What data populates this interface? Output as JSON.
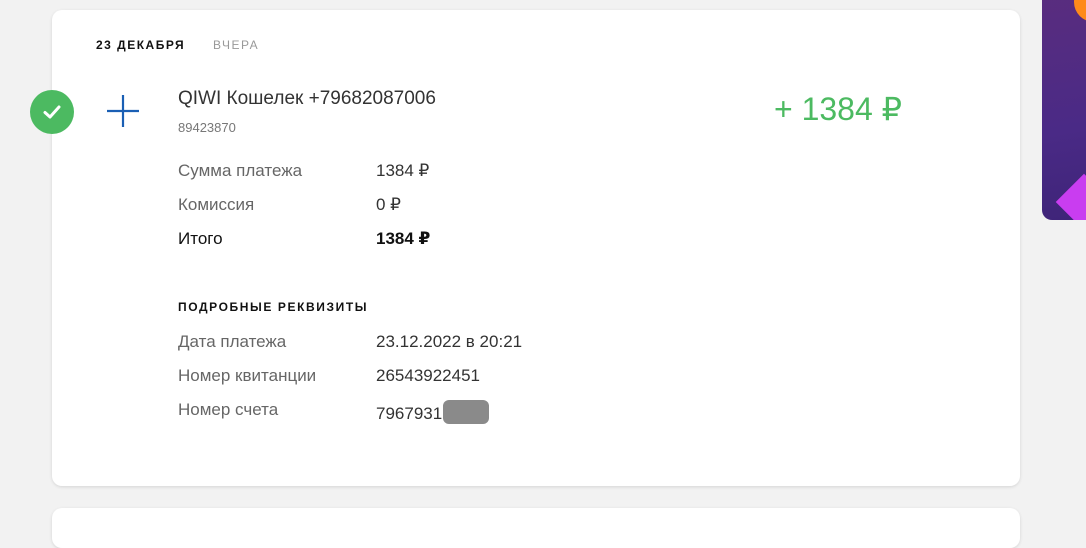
{
  "header": {
    "date": "23 ДЕКАБРЯ",
    "relative_day": "ВЧЕРА"
  },
  "transaction": {
    "status_icon": "check-icon",
    "type_icon": "plus-icon",
    "title": "QIWI Кошелек +79682087006",
    "subtitle": "89423870",
    "amount": "+ 1384 ₽",
    "amount_color": "#4cba61"
  },
  "summary": [
    {
      "label": "Сумма платежа",
      "value": "1384 ₽"
    },
    {
      "label": "Комиссия",
      "value": "0 ₽"
    },
    {
      "label": "Итого",
      "value": "1384 ₽"
    }
  ],
  "details": {
    "title": "ПОДРОБНЫЕ РЕКВИЗИТЫ",
    "rows": [
      {
        "label": "Дата платежа",
        "value": "23.12.2022 в 20:21"
      },
      {
        "label": "Номер квитанции",
        "value": "26543922451"
      },
      {
        "label": "Номер счета",
        "value": "7967931"
      }
    ]
  },
  "colors": {
    "accent_green": "#4cba61",
    "icon_blue": "#1a5fb4"
  }
}
